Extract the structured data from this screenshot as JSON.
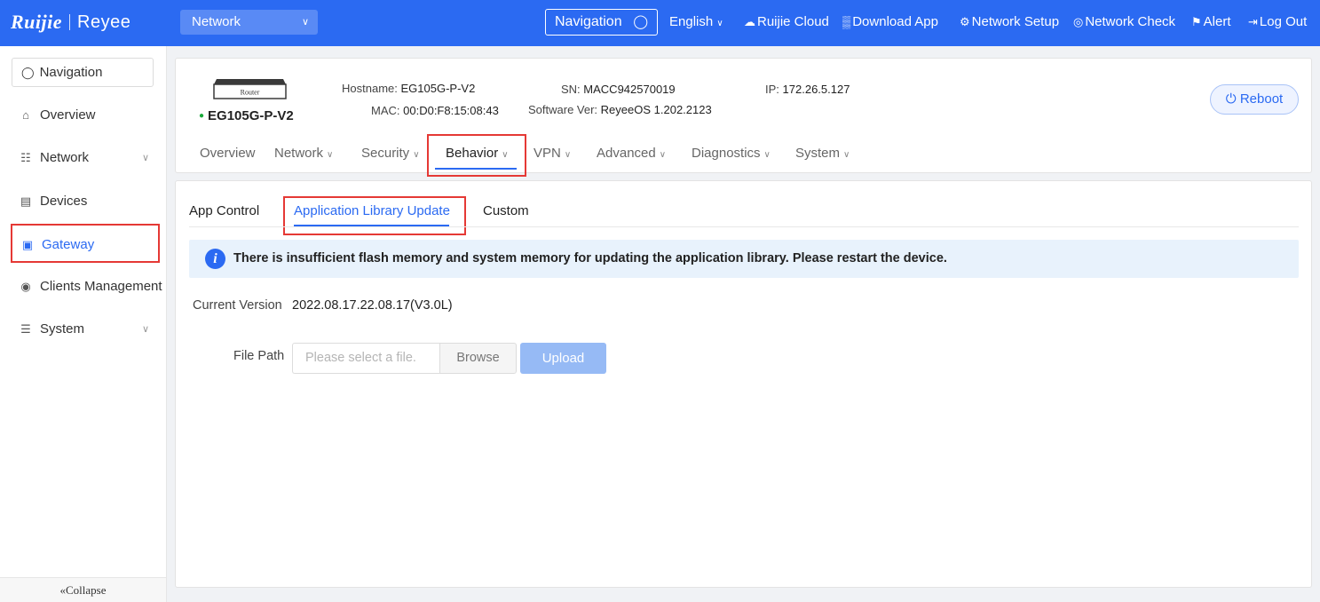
{
  "topbar": {
    "logo_primary": "Ruijie",
    "logo_secondary": "Reyee",
    "network_select": "Network",
    "navigation_search": "Navigation",
    "language": "English",
    "ruijie_cloud": "Ruijie Cloud",
    "download_app": "Download App",
    "network_setup": "Network Setup",
    "network_check": "Network Check",
    "alert": "Alert",
    "log_out": "Log Out"
  },
  "sidebar": {
    "search": "Navigation",
    "items": [
      {
        "label": "Overview"
      },
      {
        "label": "Network"
      },
      {
        "label": "Devices"
      },
      {
        "label": "Gateway"
      },
      {
        "label": "Clients Management"
      },
      {
        "label": "System"
      }
    ],
    "collapse": "Collapse"
  },
  "device": {
    "image_label": "Router",
    "name": "EG105G-P-V2",
    "hostname_label": "Hostname:",
    "hostname": "EG105G-P-V2",
    "mac_label": "MAC:",
    "mac": "00:D0:F8:15:08:43",
    "sn_label": "SN:",
    "sn": "MACC942570019",
    "software_label": "Software Ver:",
    "software": "ReyeeOS 1.202.2123",
    "ip_label": "IP:",
    "ip": "172.26.5.127",
    "reboot": "Reboot",
    "tabs": [
      {
        "label": "Overview"
      },
      {
        "label": "Network"
      },
      {
        "label": "Security"
      },
      {
        "label": "Behavior"
      },
      {
        "label": "VPN"
      },
      {
        "label": "Advanced"
      },
      {
        "label": "Diagnostics"
      },
      {
        "label": "System"
      }
    ]
  },
  "content": {
    "subtabs": [
      {
        "label": "App Control"
      },
      {
        "label": "Application Library Update"
      },
      {
        "label": "Custom"
      }
    ],
    "alert_text": "There is insufficient flash memory and system memory for updating the application library. Please restart the device.",
    "current_version_label": "Current Version",
    "current_version": "2022.08.17.22.08.17(V3.0L)",
    "file_path_label": "File Path",
    "file_placeholder": "Please select a file.",
    "browse": "Browse",
    "upload": "Upload"
  },
  "colors": {
    "brand": "#2b6af2",
    "highlight": "#e53935",
    "online": "#1aaa3a"
  }
}
